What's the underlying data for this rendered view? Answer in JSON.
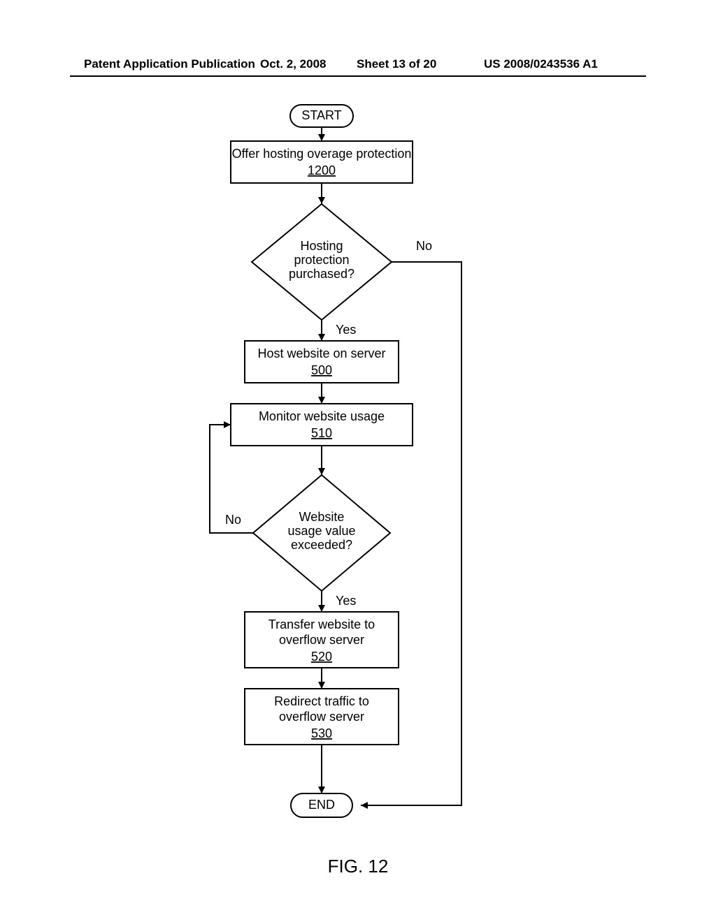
{
  "header": {
    "left": "Patent Application Publication",
    "date": "Oct. 2, 2008",
    "sheet": "Sheet 13 of 20",
    "pubno": "US 2008/0243536 A1"
  },
  "fig_caption": "FIG. 12",
  "nodes": {
    "start": "START",
    "end": "END",
    "offer": "Offer hosting overage protection",
    "offer_ref": "1200",
    "d1_l1": "Hosting",
    "d1_l2": "protection",
    "d1_l3": "purchased?",
    "host": "Host website on server",
    "host_ref": "500",
    "monitor": "Monitor website usage",
    "monitor_ref": "510",
    "d2_l1": "Website",
    "d2_l2": "usage value",
    "d2_l3": "exceeded?",
    "transfer_l1": "Transfer website to",
    "transfer_l2": "overflow server",
    "transfer_ref": "520",
    "redirect_l1": "Redirect traffic to",
    "redirect_l2": "overflow server",
    "redirect_ref": "530"
  },
  "labels": {
    "yes": "Yes",
    "no": "No"
  }
}
